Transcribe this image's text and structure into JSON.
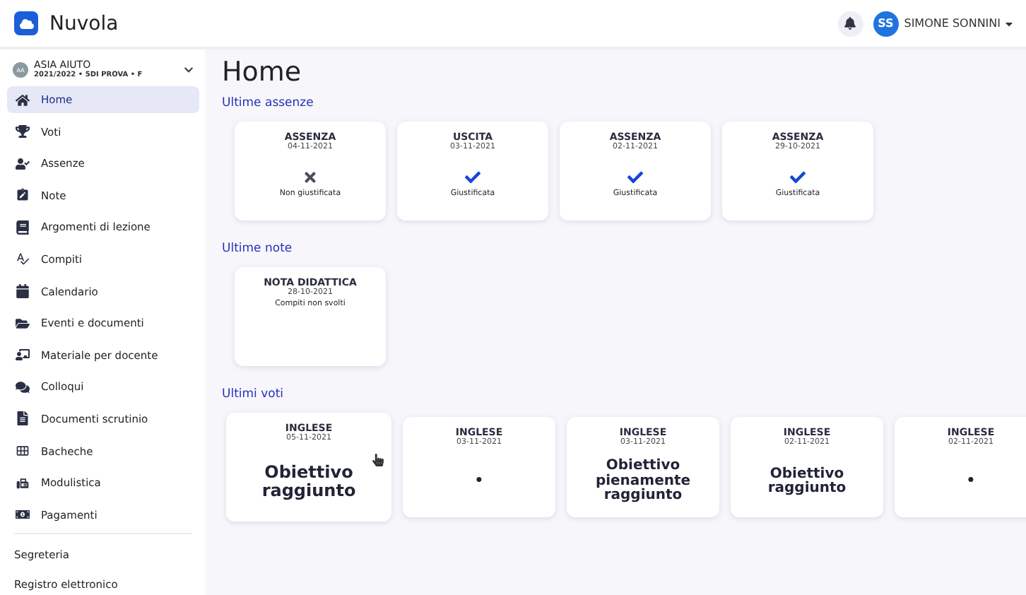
{
  "header": {
    "app_name": "Nuvola",
    "user_initials": "SS",
    "user_name": "SIMONE SONNINI"
  },
  "sidebar": {
    "profile": {
      "initials": "AA",
      "name": "ASIA AIUTO",
      "detail": "2021/2022 • 5DI PROVA • F"
    },
    "items": [
      {
        "label": "Home",
        "selected": true
      },
      {
        "label": "Voti",
        "selected": false
      },
      {
        "label": "Assenze",
        "selected": false
      },
      {
        "label": "Note",
        "selected": false
      },
      {
        "label": "Argomenti di lezione",
        "selected": false
      },
      {
        "label": "Compiti",
        "selected": false
      },
      {
        "label": "Calendario",
        "selected": false
      },
      {
        "label": "Eventi e documenti",
        "selected": false
      },
      {
        "label": "Materiale per docente",
        "selected": false
      },
      {
        "label": "Colloqui",
        "selected": false
      },
      {
        "label": "Documenti scrutinio",
        "selected": false
      },
      {
        "label": "Bacheche",
        "selected": false
      },
      {
        "label": "Modulistica",
        "selected": false
      },
      {
        "label": "Pagamenti",
        "selected": false
      }
    ],
    "links": [
      "Segreteria",
      "Registro elettronico"
    ]
  },
  "page_title": "Home",
  "absences": {
    "title": "Ultime assenze",
    "items": [
      {
        "type": "ASSENZA",
        "date": "04-11-2021",
        "justified": false,
        "status": "Non giustificata"
      },
      {
        "type": "USCITA",
        "date": "03-11-2021",
        "justified": true,
        "status": "Giustificata"
      },
      {
        "type": "ASSENZA",
        "date": "02-11-2021",
        "justified": true,
        "status": "Giustificata"
      },
      {
        "type": "ASSENZA",
        "date": "29-10-2021",
        "justified": true,
        "status": "Giustificata"
      }
    ]
  },
  "notes": {
    "title": "Ultime note",
    "items": [
      {
        "type": "NOTA DIDATTICA",
        "date": "28-10-2021",
        "text": "Compiti non svolti"
      }
    ]
  },
  "grades": {
    "title": "Ultimi voti",
    "items": [
      {
        "subject": "INGLESE",
        "date": "05-11-2021",
        "grade": "Obiettivo raggiunto",
        "hovered": true
      },
      {
        "subject": "INGLESE",
        "date": "03-11-2021",
        "grade": "•",
        "hovered": false
      },
      {
        "subject": "INGLESE",
        "date": "03-11-2021",
        "grade": "Obiettivo pienamente raggiunto",
        "hovered": false
      },
      {
        "subject": "INGLESE",
        "date": "02-11-2021",
        "grade": "Obiettivo raggiunto",
        "hovered": false
      },
      {
        "subject": "INGLESE",
        "date": "02-11-2021",
        "grade": "•",
        "hovered": false
      }
    ]
  }
}
